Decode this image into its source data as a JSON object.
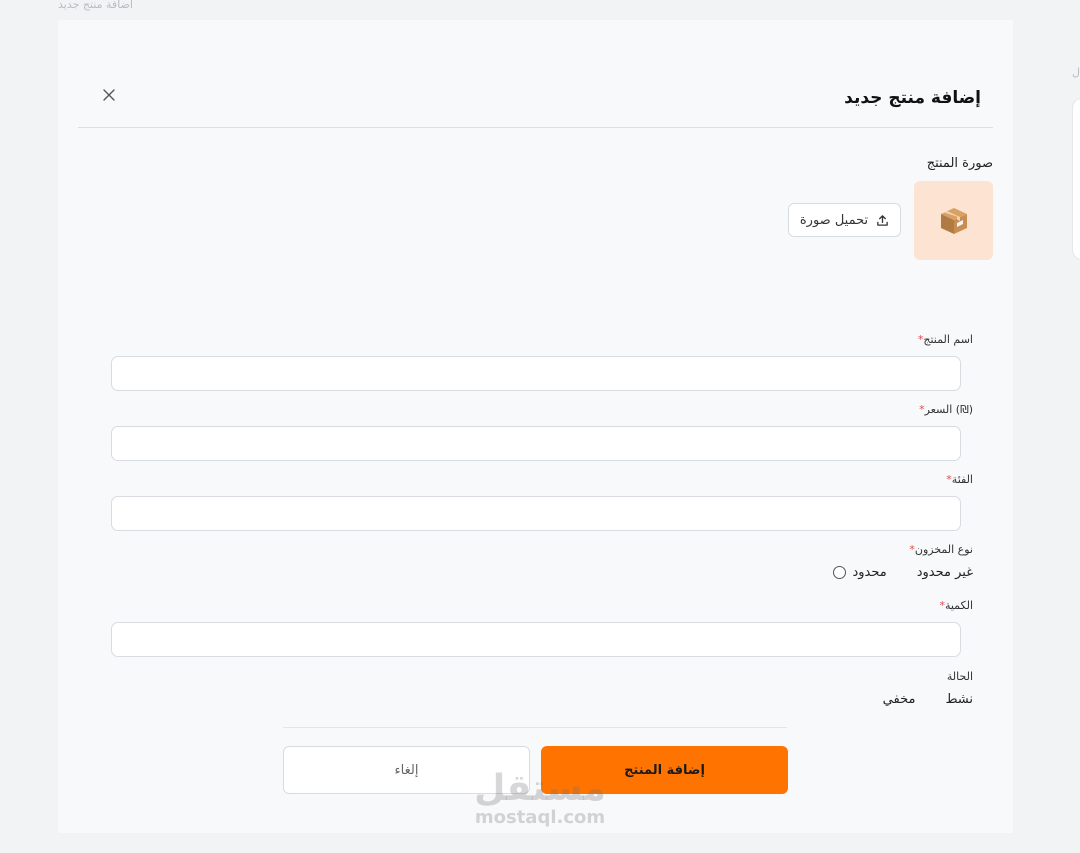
{
  "background": {
    "caption": "اضافة منتج جديد",
    "edge_text": "ل"
  },
  "modal": {
    "title": "إضافة منتج جديد",
    "close_icon": "close-icon",
    "image_label": "صورة المنتج",
    "image_icon": "package-icon",
    "upload_label": "تحميل صورة",
    "upload_icon": "upload-icon",
    "fields": {
      "name": {
        "label": "اسم المنتج",
        "value": "",
        "required": "*"
      },
      "price": {
        "label": "السعر (₪)",
        "value": "",
        "required": "*"
      },
      "category": {
        "label": "الفئة",
        "value": "",
        "required": "*"
      },
      "stock_type": {
        "label": "نوع المخزون",
        "required": "*",
        "options": [
          "غير محدود",
          "محدود"
        ]
      },
      "quantity": {
        "label": "الكمية",
        "value": "",
        "required": "*"
      },
      "status": {
        "label": "الحالة",
        "options": [
          "نشط",
          "مخفي"
        ]
      }
    },
    "submit_label": "إضافة المنتج",
    "cancel_label": "إلغاء"
  },
  "watermark": {
    "arabic": "مستقل",
    "latin": "mostaql.com"
  },
  "colors": {
    "accent": "#ff7300",
    "image_box": "#fde3d2",
    "required": "#e5484d"
  }
}
